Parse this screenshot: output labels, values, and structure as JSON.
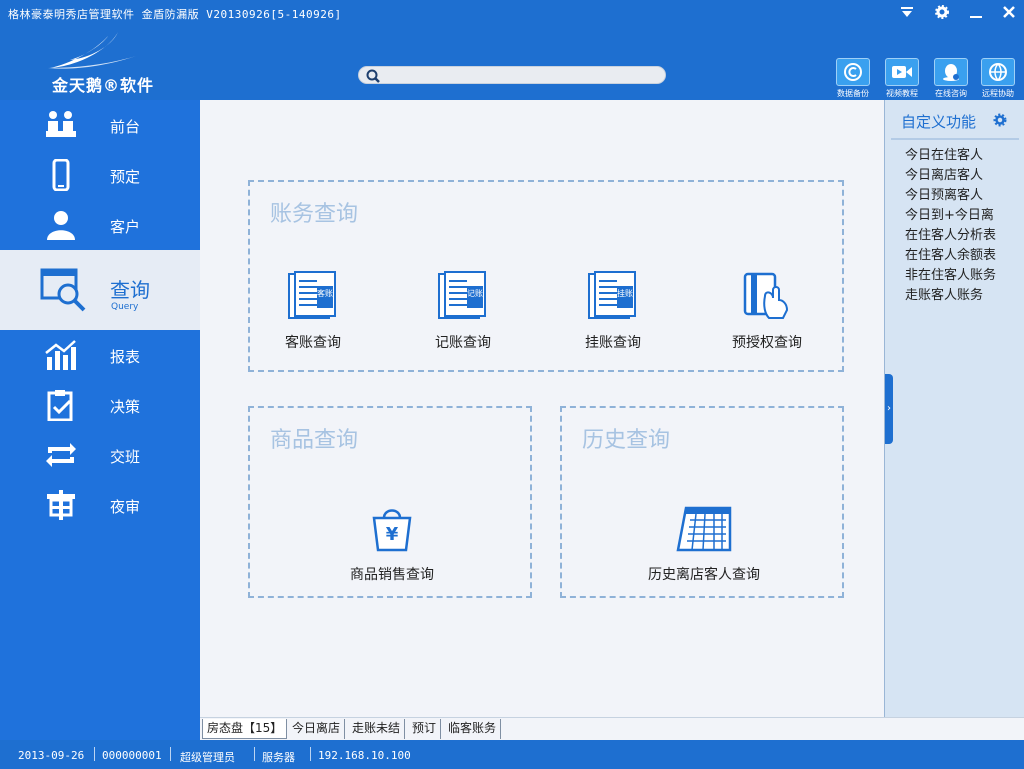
{
  "window": {
    "title": "格林豪泰明秀店管理软件 金盾防漏版 V20130926[5-140926]",
    "controls": [
      "dropdown-icon",
      "gear-icon",
      "minimize-icon",
      "close-icon"
    ]
  },
  "header": {
    "logo_text": "金天鹅®软件",
    "search": {
      "placeholder": "",
      "value": ""
    },
    "buttons": [
      {
        "label": "数据备份",
        "icon": "backup-icon"
      },
      {
        "label": "视频教程",
        "icon": "video-icon"
      },
      {
        "label": "在线咨询",
        "icon": "chat-icon"
      },
      {
        "label": "远程协助",
        "icon": "remote-icon"
      }
    ]
  },
  "sidebar": {
    "items": [
      {
        "label": "前台",
        "icon": "front-desk-icon"
      },
      {
        "label": "预定",
        "icon": "phone-icon"
      },
      {
        "label": "客户",
        "icon": "user-icon"
      },
      {
        "label": "查询",
        "sublabel": "Query",
        "icon": "query-icon",
        "active": true
      },
      {
        "label": "报表",
        "icon": "report-icon"
      },
      {
        "label": "决策",
        "icon": "decision-icon"
      },
      {
        "label": "交班",
        "icon": "shift-icon"
      },
      {
        "label": "夜审",
        "icon": "night-audit-icon"
      }
    ]
  },
  "main": {
    "sections": {
      "account": {
        "title": "账务查询",
        "tiles": [
          {
            "label": "客账查询",
            "icon": "guest-account-icon",
            "tag": "客账"
          },
          {
            "label": "记账查询",
            "icon": "ledger-icon",
            "tag": "记账"
          },
          {
            "label": "挂账查询",
            "icon": "credit-icon",
            "tag": "挂账"
          },
          {
            "label": "预授权查询",
            "icon": "card-icon"
          }
        ]
      },
      "goods": {
        "title": "商品查询",
        "tiles": [
          {
            "label": "商品销售查询",
            "icon": "shopping-bag-icon"
          }
        ]
      },
      "history": {
        "title": "历史查询",
        "tiles": [
          {
            "label": "历史离店客人查询",
            "icon": "calendar-icon"
          }
        ]
      }
    }
  },
  "right_panel": {
    "title": "自定义功能",
    "items": [
      "今日在住客人",
      "今日离店客人",
      "今日预离客人",
      "今日到+今日离",
      "在住客人分析表",
      "在住客人余额表",
      "非在住客人账务",
      "走账客人账务"
    ]
  },
  "bottom_tabs": [
    {
      "label": "房态盘【15】",
      "active": true
    },
    {
      "label": "今日离店"
    },
    {
      "label": "走账未结"
    },
    {
      "label": "预订"
    },
    {
      "label": "临客账务"
    }
  ],
  "status": {
    "date": "2013-09-26",
    "user_id": "000000001",
    "role": "超级管理员",
    "server_label": "服务器",
    "server_ip": "192.168.10.100"
  },
  "colors": {
    "primary": "#1e6fd0",
    "sidebar": "#1f72dc",
    "content_bg": "#f2f4f9",
    "section_title": "#a7c3e2",
    "right_panel": "#d6e4f3"
  }
}
